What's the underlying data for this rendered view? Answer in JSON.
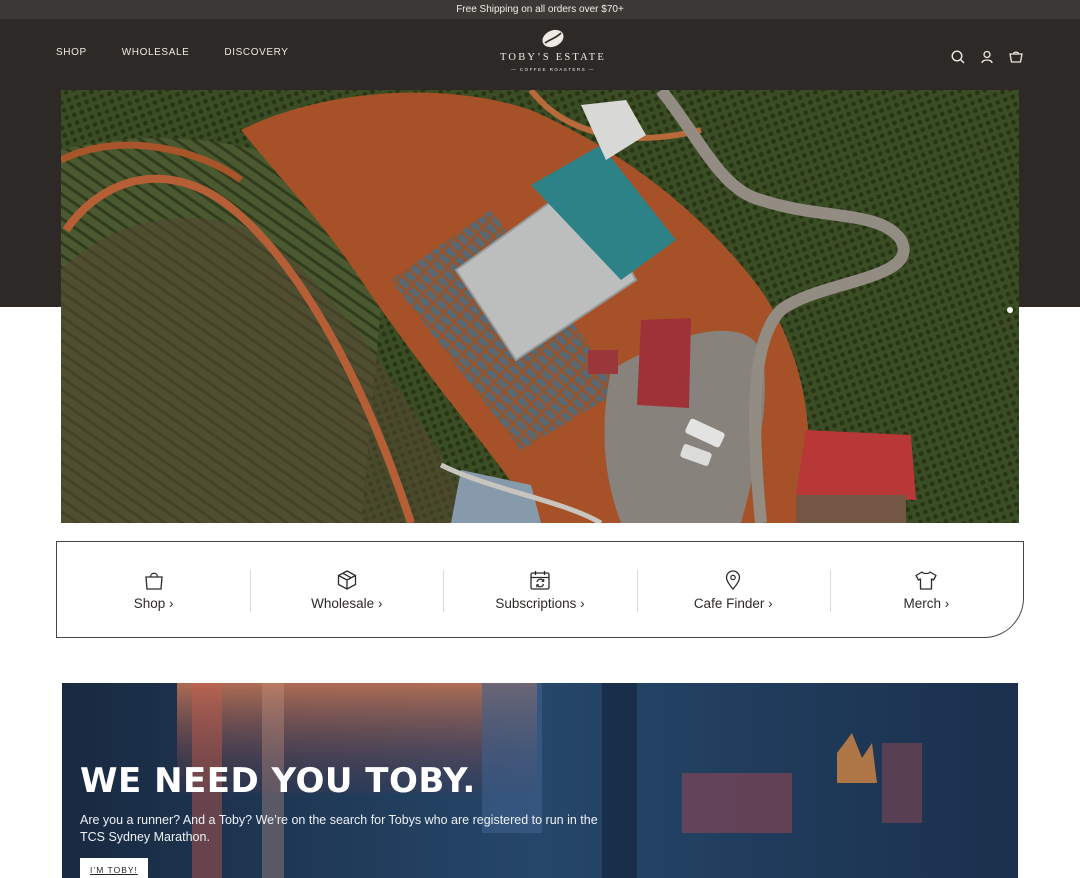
{
  "announcement": "Free Shipping on all orders over $70+",
  "nav": {
    "items": [
      "SHOP",
      "WHOLESALE",
      "DISCOVERY"
    ]
  },
  "logo": {
    "brand": "TOBY’S ESTATE",
    "tagline": "— COFFEE ROASTERS —"
  },
  "header_icons": [
    "search-icon",
    "account-icon",
    "cart-icon"
  ],
  "hero": {
    "slide_count": 1,
    "active_slide": 1
  },
  "categories": [
    {
      "label": "Shop ›",
      "icon": "bag-icon"
    },
    {
      "label": "Wholesale ›",
      "icon": "box-icon"
    },
    {
      "label": "Subscriptions ›",
      "icon": "calendar-refresh-icon"
    },
    {
      "label": "Cafe Finder ›",
      "icon": "map-pin-icon"
    },
    {
      "label": "Merch ›",
      "icon": "tshirt-icon"
    }
  ],
  "promo": {
    "heading": "WE NEED YOU TOBY.",
    "body": "Are you a runner? And a Toby? We’re on the search for Tobys who are registered to run in the TCS Sydney Marathon.",
    "cta": "I’M TOBY!"
  },
  "colors": {
    "header_bg": "#2d2927",
    "announcement_bg": "#3b3835",
    "text_light": "#efe9e2"
  }
}
